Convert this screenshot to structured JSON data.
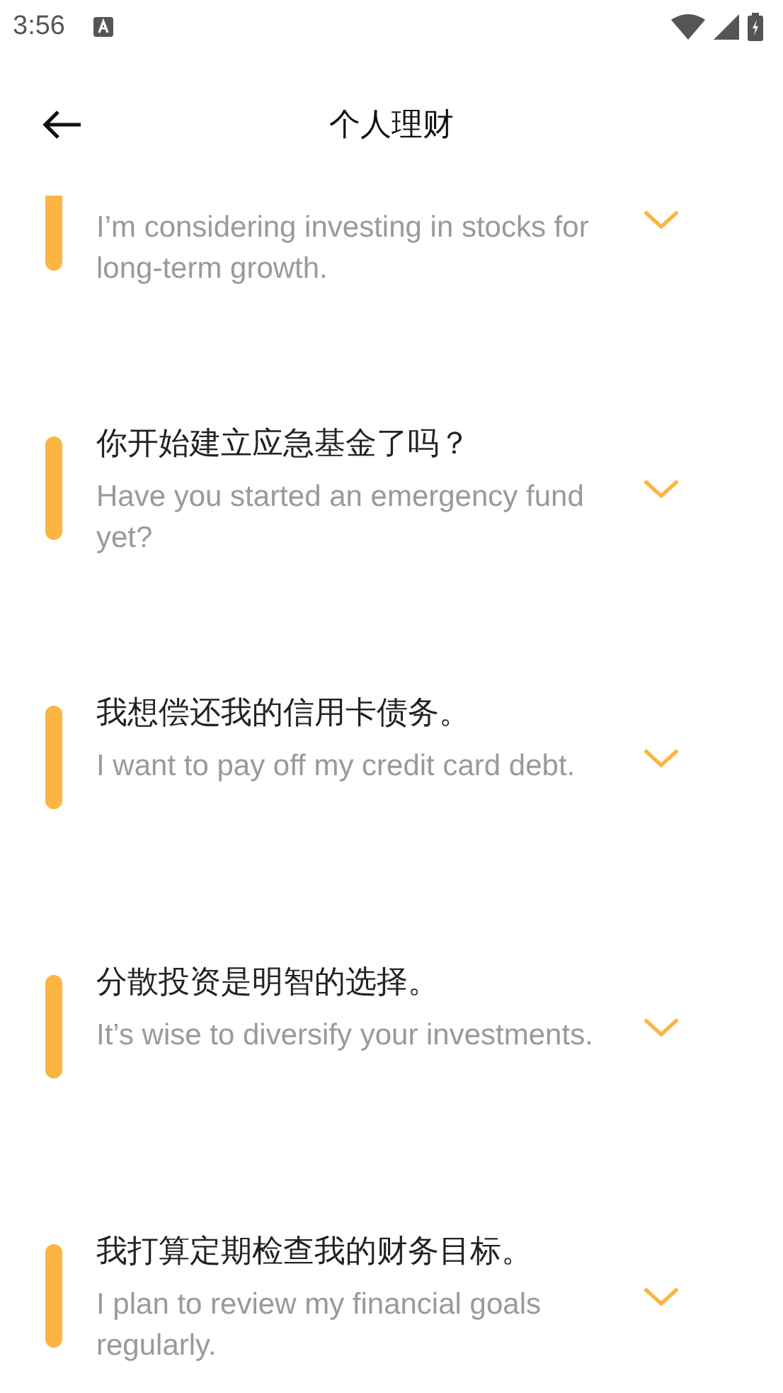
{
  "status_bar": {
    "time": "3:56"
  },
  "app_bar": {
    "title": "个人理财"
  },
  "phrases": [
    {
      "en": "I’m considering investing in stocks for long-term growth.",
      "expanded": false
    },
    {
      "zh": "你开始建立应急基金了吗？",
      "en": "Have you started an emergency fund yet?",
      "expanded": false
    },
    {
      "zh": "我想偿还我的信用卡债务。",
      "en": "I want to pay off my credit card debt.",
      "expanded": false
    },
    {
      "zh": "分散投资是明智的选择。",
      "en": "It’s wise to diversify your investments.",
      "expanded": false
    },
    {
      "zh": "我打算定期检查我的财务目标。",
      "en": "I plan to review my financial goals regularly.",
      "expanded": false
    }
  ]
}
